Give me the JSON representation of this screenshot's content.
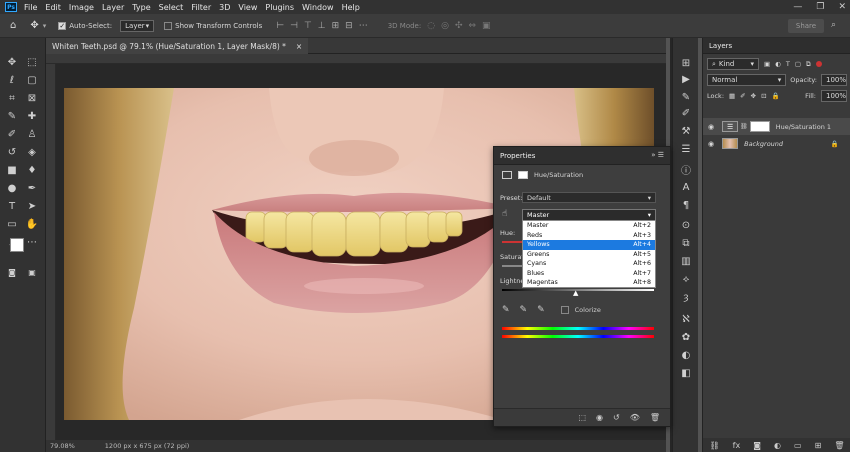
{
  "app": {
    "logo": "Ps",
    "menu": [
      "File",
      "Edit",
      "Image",
      "Layer",
      "Type",
      "Select",
      "Filter",
      "3D",
      "View",
      "Plugins",
      "Window",
      "Help"
    ],
    "window_controls": [
      "—",
      "❐",
      "✕"
    ]
  },
  "options": {
    "auto_select_label": "Auto-Select:",
    "auto_select_value": "Layer",
    "transform_label": "Show Transform Controls",
    "mode_3d_label": "3D Mode:",
    "share_label": "Share"
  },
  "document": {
    "tab_title": "Whiten Teeth.psd @ 79.1% (Hue/Saturation 1, Layer Mask/8) *",
    "close_glyph": "×",
    "zoom": "79.08%",
    "doc_info": "1200 px x 675 px (72 ppi)"
  },
  "properties": {
    "title": "Properties",
    "adjustment": "Hue/Saturation",
    "preset_label": "Preset:",
    "preset_value": "Default",
    "channel_value": "Master",
    "hue_label": "Hue:",
    "saturation_label": "Saturation",
    "lightness_label": "Lightness",
    "colorize_label": "Colorize",
    "channels": [
      {
        "name": "Master",
        "shortcut": "Alt+2"
      },
      {
        "name": "Reds",
        "shortcut": "Alt+3"
      },
      {
        "name": "Yellows",
        "shortcut": "Alt+4"
      },
      {
        "name": "Greens",
        "shortcut": "Alt+5"
      },
      {
        "name": "Cyans",
        "shortcut": "Alt+6"
      },
      {
        "name": "Blues",
        "shortcut": "Alt+7"
      },
      {
        "name": "Magentas",
        "shortcut": "Alt+8"
      }
    ],
    "highlighted_channel": "Yellows"
  },
  "layers": {
    "title": "Layers",
    "filter_value": "Kind",
    "blend_mode": "Normal",
    "opacity_label": "Opacity:",
    "opacity_value": "100%",
    "lock_label": "Lock:",
    "fill_label": "Fill:",
    "fill_value": "100%",
    "items": [
      {
        "name": "Hue/Saturation 1",
        "active": true
      },
      {
        "name": "Background",
        "active": false
      }
    ]
  },
  "colors": {
    "accent": "#31a8ff",
    "selection": "#1c7ae0"
  }
}
